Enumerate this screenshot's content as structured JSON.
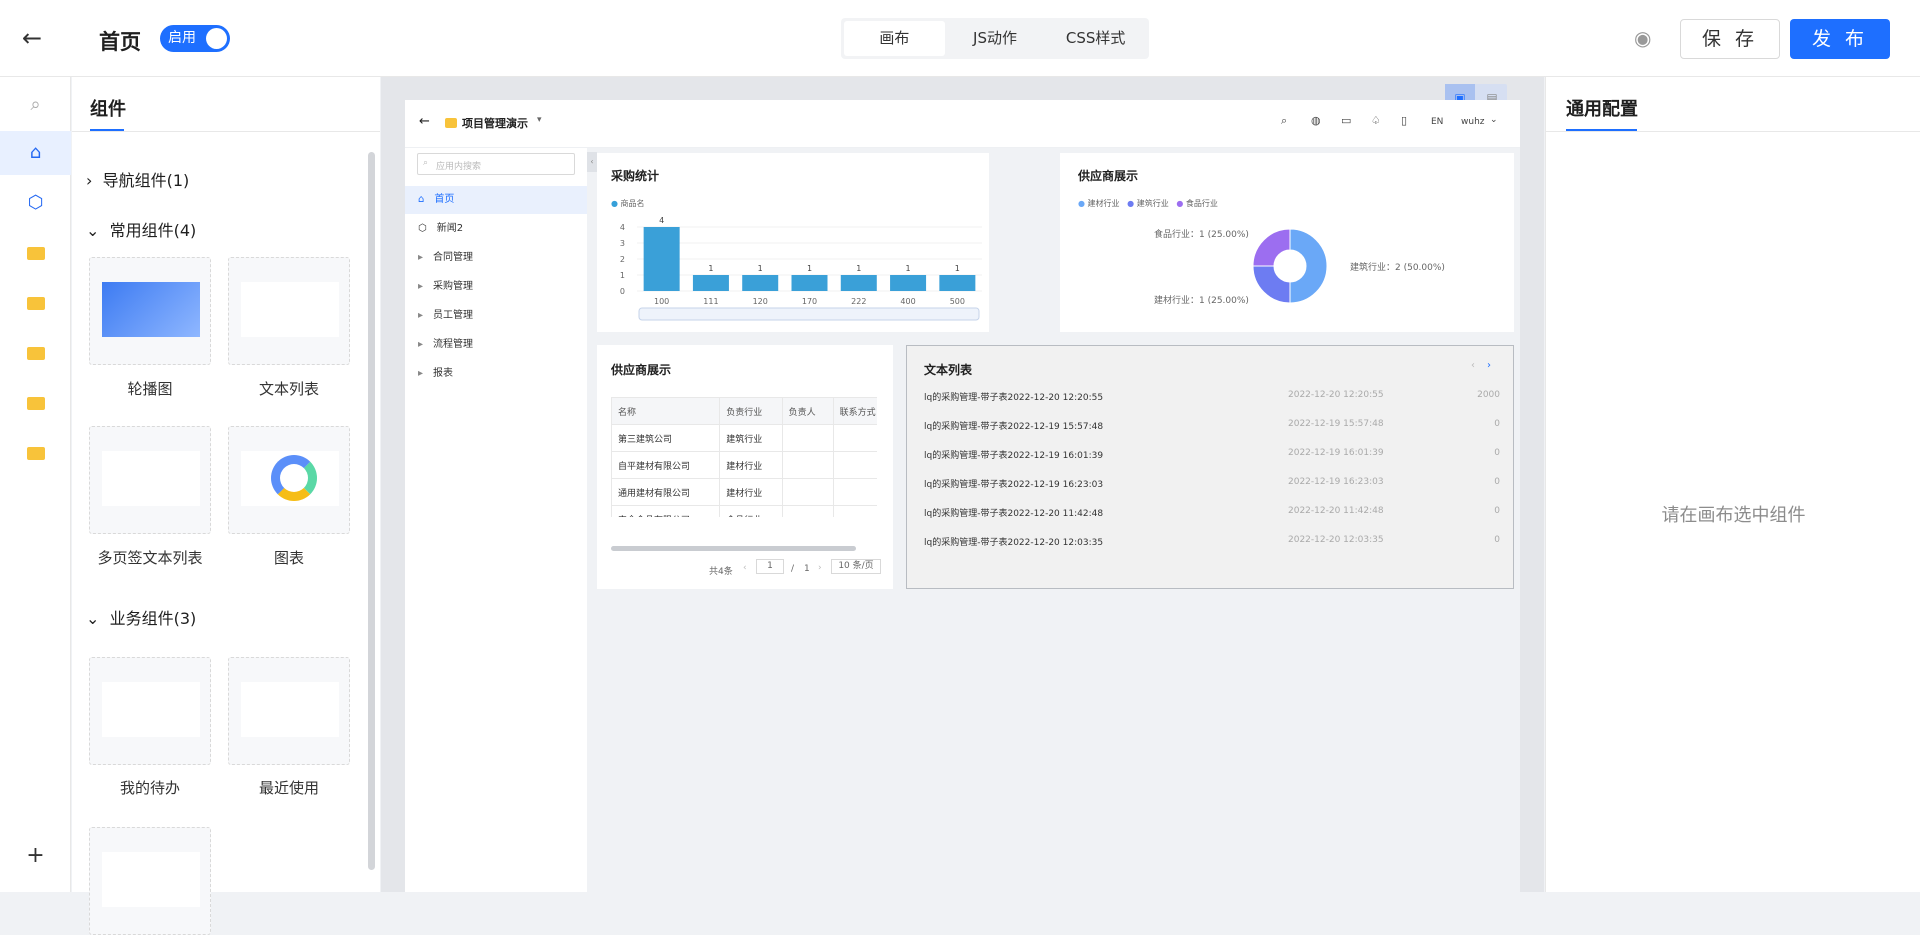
{
  "header": {
    "page_title": "首页",
    "toggle_label": "启用",
    "tabs": [
      "画布",
      "JS动作",
      "CSS样式"
    ],
    "save_label": "保 存",
    "publish_label": "发 布"
  },
  "library": {
    "title": "组件",
    "groups": [
      {
        "label": "导航组件(1)"
      },
      {
        "label": "常用组件(4)"
      },
      {
        "label": "业务组件(3)"
      }
    ],
    "common": [
      "轮播图",
      "文本列表",
      "多页签文本列表",
      "图表"
    ],
    "business": [
      "我的待办",
      "最近使用"
    ]
  },
  "app": {
    "name": "项目管理演示",
    "search_placeholder": "应用内搜索",
    "lang": "EN",
    "user": "wuhz",
    "nav": [
      {
        "label": "首页"
      },
      {
        "label": "新闻2"
      },
      {
        "label": "合同管理"
      },
      {
        "label": "采购管理"
      },
      {
        "label": "员工管理"
      },
      {
        "label": "流程管理"
      },
      {
        "label": "报表"
      }
    ]
  },
  "purchase": {
    "title": "采购统计",
    "legend": "商品名",
    "chart_data": {
      "type": "bar",
      "categories": [
        "100",
        "111",
        "120",
        "170",
        "222",
        "400",
        "500"
      ],
      "values": [
        4,
        1,
        1,
        1,
        1,
        1,
        1
      ],
      "ylim": [
        0,
        4
      ],
      "yticks": [
        "4",
        "3",
        "2",
        "1",
        "0"
      ],
      "series": [
        {
          "name": "商品名",
          "values": [
            4,
            1,
            1,
            1,
            1,
            1,
            1
          ]
        }
      ]
    }
  },
  "supplier_pie": {
    "title": "供应商展示",
    "legend": [
      "建材行业",
      "建筑行业",
      "食品行业"
    ],
    "labels": [
      "食品行业：1 (25.00%)",
      "建筑行业：2 (50.00%)",
      "建材行业：1 (25.00%)"
    ],
    "chart_data": {
      "type": "pie",
      "categories": [
        "建筑行业",
        "建材行业",
        "食品行业"
      ],
      "values": [
        2,
        1,
        1
      ]
    },
    "colors": [
      "#6aa8f7",
      "#6d7cf2",
      "#9c6ef0"
    ]
  },
  "supplier_table": {
    "title": "供应商展示",
    "columns": [
      "名称",
      "负责行业",
      "负责人",
      "联系方式"
    ],
    "rows": [
      [
        "第三建筑公司",
        "建筑行业",
        "",
        ""
      ],
      [
        "自平建材有限公司",
        "建材行业",
        "",
        ""
      ],
      [
        "通用建材有限公司",
        "建材行业",
        "",
        ""
      ],
      [
        "安全食品有限公司",
        "食品行业",
        "",
        ""
      ]
    ],
    "total": "共4条",
    "page": "1",
    "sep": "/",
    "pages": "1",
    "page_size": "10 条/页"
  },
  "textlist": {
    "title": "文本列表",
    "items": [
      {
        "title": "lq的采购管理-带子表2022-12-20 12:20:55",
        "time": "2022-12-20 12:20:55",
        "num": "2000"
      },
      {
        "title": "lq的采购管理-带子表2022-12-19 15:57:48",
        "time": "2022-12-19 15:57:48",
        "num": "0"
      },
      {
        "title": "lq的采购管理-带子表2022-12-19 16:01:39",
        "time": "2022-12-19 16:01:39",
        "num": "0"
      },
      {
        "title": "lq的采购管理-带子表2022-12-19 16:23:03",
        "time": "2022-12-19 16:23:03",
        "num": "0"
      },
      {
        "title": "lq的采购管理-带子表2022-12-20 11:42:48",
        "time": "2022-12-20 11:42:48",
        "num": "0"
      },
      {
        "title": "lq的采购管理-带子表2022-12-20 12:03:35",
        "time": "2022-12-20 12:03:35",
        "num": "0"
      }
    ]
  },
  "config": {
    "title": "通用配置",
    "empty": "请在画布选中组件"
  }
}
